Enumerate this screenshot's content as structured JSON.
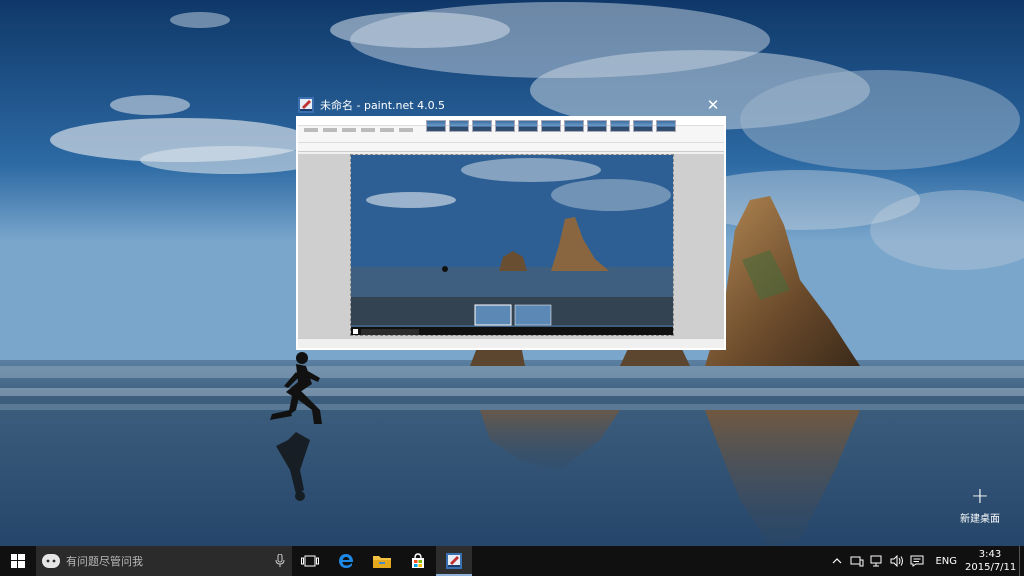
{
  "task_view": {
    "window_title": "未命名 - paint.net 4.0.5",
    "app_icon": "paintnet-icon",
    "close_icon": "close-icon"
  },
  "new_desktop": {
    "label": "新建桌面",
    "icon": "plus-icon"
  },
  "taskbar": {
    "search_placeholder": "有问题尽管问我",
    "buttons": [
      "start-icon",
      "cortana-icon",
      "mic-icon",
      "task-view-icon",
      "edge-icon",
      "file-explorer-icon",
      "store-icon",
      "paintnet-icon"
    ],
    "tray": {
      "language": "ENG",
      "time": "3:43",
      "date": "2015/7/11",
      "icons": [
        "chevron-up-icon",
        "network-icon",
        "device-icon",
        "volume-icon",
        "notification-icon"
      ]
    }
  },
  "colors": {
    "taskbar_bg": "#101010",
    "search_bg": "#2b2b2b",
    "accent": "#8fb0d8"
  }
}
